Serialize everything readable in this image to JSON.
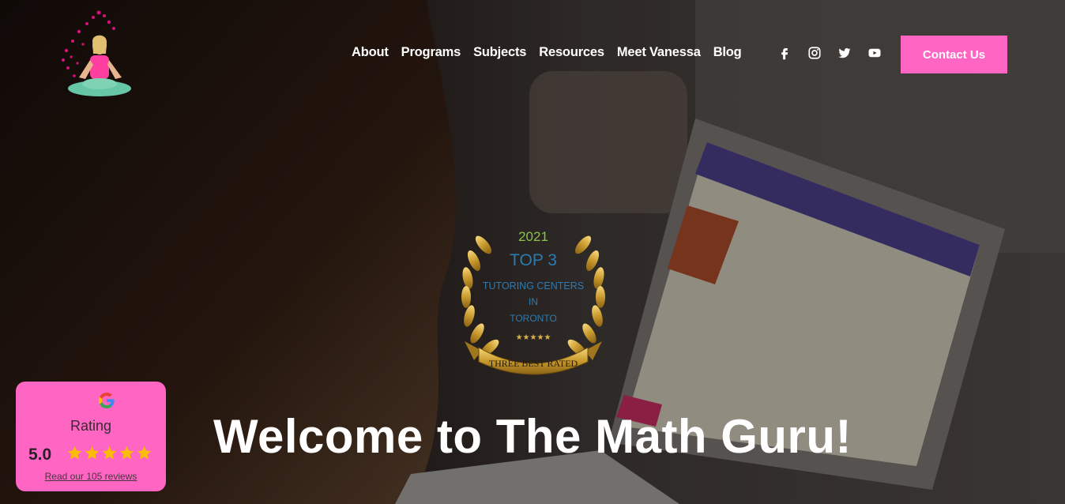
{
  "nav": {
    "items": [
      {
        "label": "About"
      },
      {
        "label": "Programs"
      },
      {
        "label": "Subjects"
      },
      {
        "label": "Resources"
      },
      {
        "label": "Meet Vanessa"
      },
      {
        "label": "Blog"
      }
    ]
  },
  "social": [
    {
      "icon": "facebook-icon"
    },
    {
      "icon": "instagram-icon"
    },
    {
      "icon": "twitter-icon"
    },
    {
      "icon": "youtube-icon"
    }
  ],
  "header": {
    "contact_label": "Contact Us"
  },
  "award": {
    "year": "2021",
    "rank": "TOP 3",
    "line1": "TUTORING CENTERS",
    "line2": "IN",
    "line3": "TORONTO",
    "stars": "★★★★★",
    "ribbon": "THREE BEST RATED"
  },
  "hero": {
    "title": "Welcome to The Math Guru!"
  },
  "rating": {
    "label": "Rating",
    "score": "5.0",
    "stars": 5,
    "reviews_link": "Read our 105 reviews"
  },
  "colors": {
    "accent": "#ff66c4",
    "text_on_dark": "#ffffff",
    "star": "#fbbc05"
  }
}
